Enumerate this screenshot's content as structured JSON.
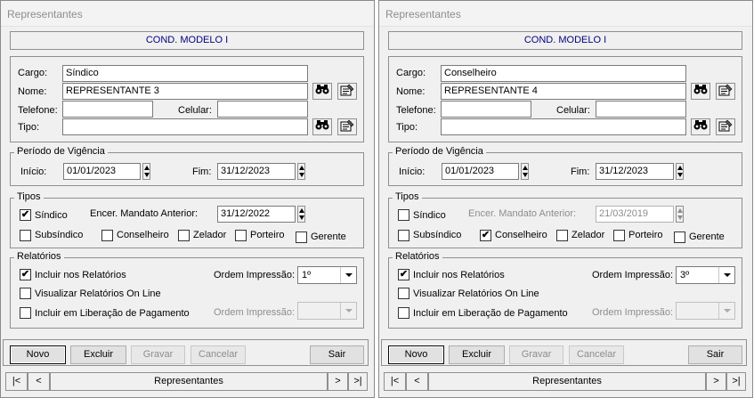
{
  "windows": [
    {
      "title": "Representantes",
      "header": "COND. MODELO I",
      "cargo_label": "Cargo:",
      "cargo": "Síndico",
      "nome_label": "Nome:",
      "nome": "REPRESENTANTE 3",
      "telefone_label": "Telefone:",
      "telefone": "",
      "celular_label": "Celular:",
      "celular": "",
      "tipo_label": "Tipo:",
      "tipo": "",
      "periodo_legend": "Período de Vigência",
      "inicio_label": "Início:",
      "inicio": "01/01/2023",
      "fim_label": "Fim:",
      "fim": "31/12/2023",
      "tipos_legend": "Tipos",
      "sindico": "Síndico",
      "sindico_checked": true,
      "encer_label": "Encer. Mandato Anterior:",
      "encer": "31/12/2022",
      "encer_enabled": true,
      "subsindico": "Subsíndico",
      "subsindico_checked": false,
      "conselheiro": "Conselheiro",
      "conselheiro_checked": false,
      "zelador": "Zelador",
      "zelador_checked": false,
      "porteiro": "Porteiro",
      "porteiro_checked": false,
      "gerente": "Gerente",
      "gerente_checked": false,
      "relatorios_legend": "Relatórios",
      "incluir_rel": "Incluir nos Relatórios",
      "incluir_rel_checked": true,
      "ordem_label": "Ordem Impressão:",
      "ordem": "1º",
      "visualizar": "Visualizar Relatórios On Line",
      "visualizar_checked": false,
      "incluir_lib": "Incluir em Liberação de Pagamento",
      "incluir_lib_checked": false,
      "ordem2_label": "Ordem Impressão:",
      "ordem2": "",
      "btn_novo": "Novo",
      "btn_excluir": "Excluir",
      "btn_gravar": "Gravar",
      "btn_cancelar": "Cancelar",
      "btn_sair": "Sair",
      "nav_first": "|<",
      "nav_prev": "<",
      "nav_title": "Representantes",
      "nav_next": ">",
      "nav_last": ">|"
    },
    {
      "title": "Representantes",
      "header": "COND. MODELO I",
      "cargo_label": "Cargo:",
      "cargo": "Conselheiro",
      "nome_label": "Nome:",
      "nome": "REPRESENTANTE 4",
      "telefone_label": "Telefone:",
      "telefone": "",
      "celular_label": "Celular:",
      "celular": "",
      "tipo_label": "Tipo:",
      "tipo": "",
      "periodo_legend": "Período de Vigência",
      "inicio_label": "Início:",
      "inicio": "01/01/2023",
      "fim_label": "Fim:",
      "fim": "31/12/2023",
      "tipos_legend": "Tipos",
      "sindico": "Síndico",
      "sindico_checked": false,
      "encer_label": "Encer. Mandato Anterior:",
      "encer": "21/03/2019",
      "encer_enabled": false,
      "subsindico": "Subsíndico",
      "subsindico_checked": false,
      "conselheiro": "Conselheiro",
      "conselheiro_checked": true,
      "zelador": "Zelador",
      "zelador_checked": false,
      "porteiro": "Porteiro",
      "porteiro_checked": false,
      "gerente": "Gerente",
      "gerente_checked": false,
      "relatorios_legend": "Relatórios",
      "incluir_rel": "Incluir nos Relatórios",
      "incluir_rel_checked": true,
      "ordem_label": "Ordem Impressão:",
      "ordem": "3º",
      "visualizar": "Visualizar Relatórios On Line",
      "visualizar_checked": false,
      "incluir_lib": "Incluir em Liberação de Pagamento",
      "incluir_lib_checked": false,
      "ordem2_label": "Ordem Impressão:",
      "ordem2": "",
      "btn_novo": "Novo",
      "btn_excluir": "Excluir",
      "btn_gravar": "Gravar",
      "btn_cancelar": "Cancelar",
      "btn_sair": "Sair",
      "nav_first": "|<",
      "nav_prev": "<",
      "nav_title": "Representantes",
      "nav_next": ">",
      "nav_last": ">|"
    }
  ]
}
